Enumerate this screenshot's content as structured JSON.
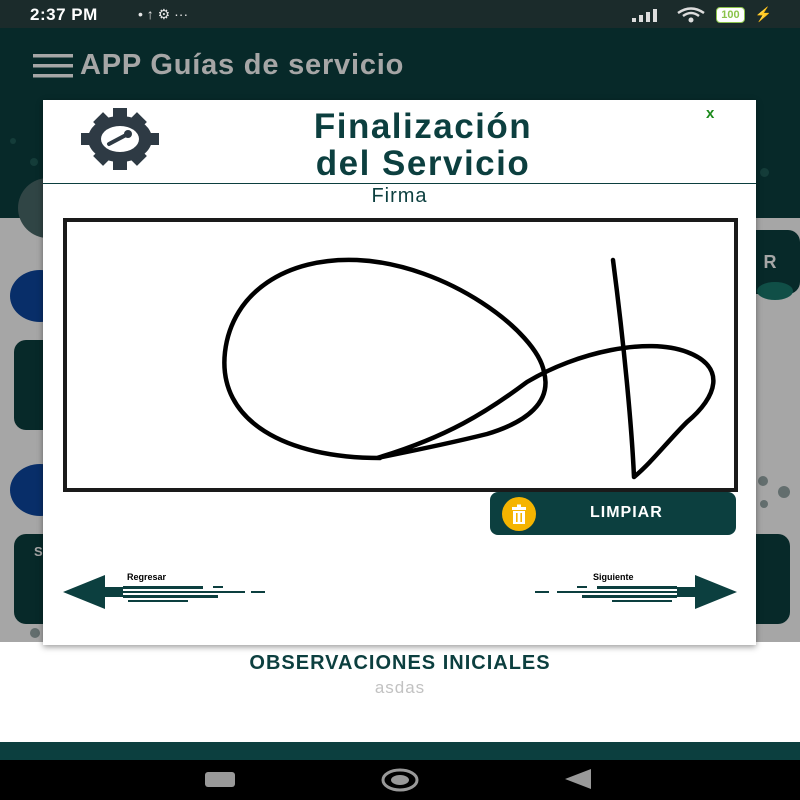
{
  "status_bar": {
    "time": "2:37 PM",
    "notifications": "• ↑ ⚙ ···",
    "battery": "100"
  },
  "app": {
    "title": "APP Guías de servicio"
  },
  "background": {
    "observations_title": "OBSERVACIONES INICIALES",
    "observations_value": "asdas",
    "partial_card_letter_r": "R",
    "partial_card_letter_s": "S"
  },
  "modal": {
    "title_line1": "Finalización",
    "title_line2": "del Servicio",
    "close_label": "x",
    "signature_label": "Firma",
    "clear_label": "LIMPIAR",
    "back_label": "Regresar",
    "next_label": "Siguiente"
  },
  "colors": {
    "primary": "#0c3f3f",
    "accent_yellow": "#f5b400",
    "blue": "#0d47a1"
  }
}
